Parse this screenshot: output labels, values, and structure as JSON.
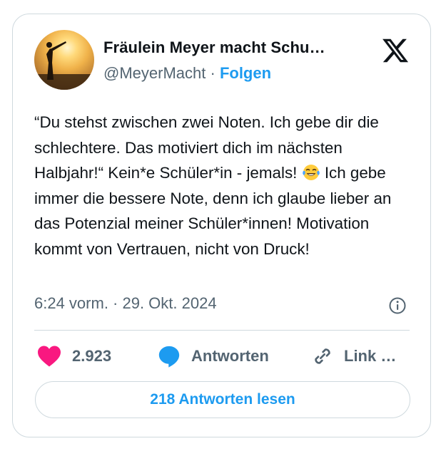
{
  "author": {
    "display_name": "Fräulein Meyer macht Schu…",
    "handle": "@MeyerMacht",
    "separator": " · ",
    "follow_label": "Folgen",
    "avatar_icon": "sunset-silhouette-avatar"
  },
  "brand": {
    "logo_icon": "x-logo-icon"
  },
  "tweet": {
    "text_before_emoji": "“Du stehst zwischen zwei Noten. Ich gebe dir die schlechtere. Das motiviert dich im nächsten Halbjahr!“ Kein*e Schüler*in - jemals! ",
    "emoji": "😂",
    "text_after_emoji": " Ich gebe immer die bessere Note, denn ich glaube lieber an das Potenzial meiner Schüler*innen! Motivation kommt von Vertrauen, nicht von Druck!",
    "timestamp": "6:24 vorm. · 29. Okt. 2024"
  },
  "actions": {
    "like_count": "2.923",
    "reply_label": "Antworten",
    "link_label": "Link …"
  },
  "footer": {
    "read_replies_label": "218 Antworten lesen"
  },
  "colors": {
    "accent": "#1d9bf0",
    "like": "#f91880",
    "text": "#0f1419",
    "muted": "#536471",
    "border": "#cfd9de"
  }
}
